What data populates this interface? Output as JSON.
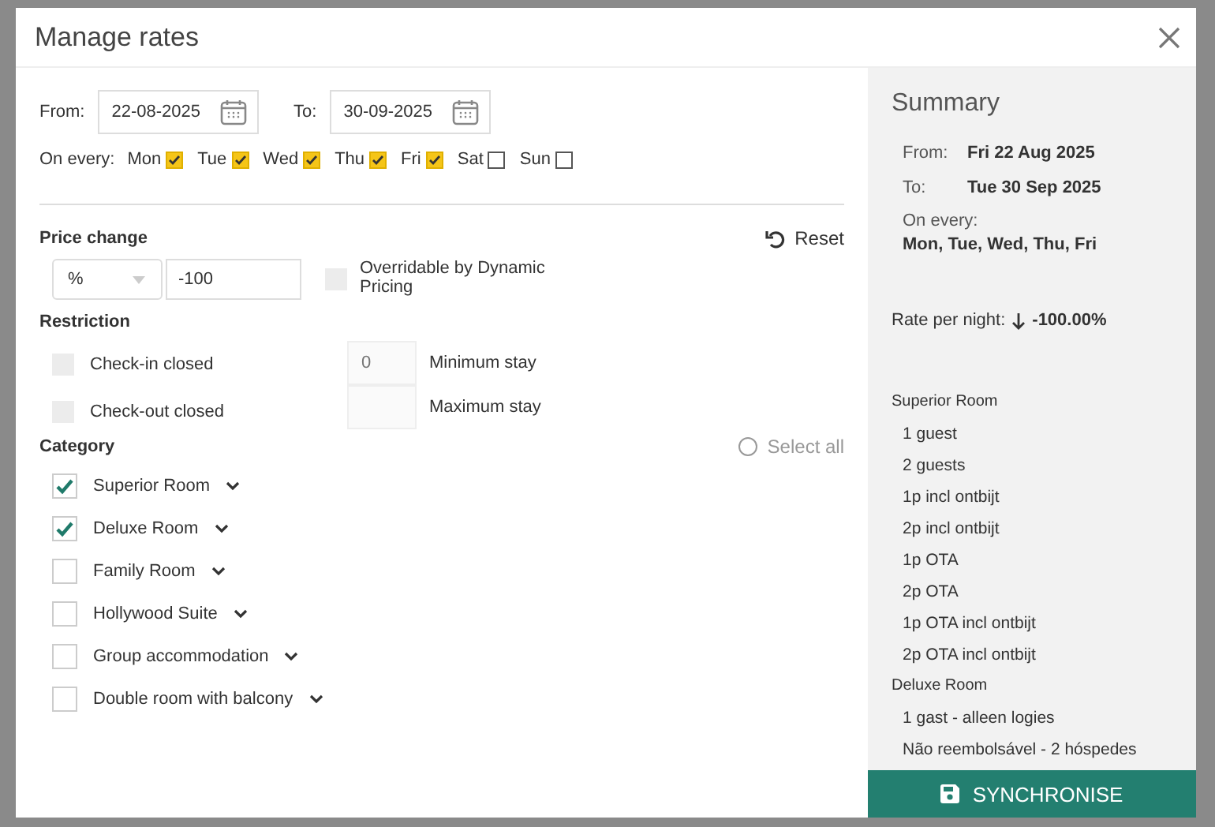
{
  "window": {
    "title": "Manage rates"
  },
  "dates": {
    "from": {
      "label": "From:",
      "value": "22-08-2025"
    },
    "to": {
      "label": "To:",
      "value": "30-09-2025"
    }
  },
  "weekdays": {
    "label": "On every:",
    "days": [
      {
        "label": "Mon",
        "checked": true
      },
      {
        "label": "Tue",
        "checked": true
      },
      {
        "label": "Wed",
        "checked": true
      },
      {
        "label": "Thu",
        "checked": true
      },
      {
        "label": "Fri",
        "checked": true
      },
      {
        "label": "Sat",
        "checked": false
      },
      {
        "label": "Sun",
        "checked": false
      }
    ]
  },
  "price_change": {
    "title": "Price change",
    "reset": "Reset",
    "unit": "%",
    "amount": "-100",
    "overridable": {
      "label": "Overridable by Dynamic Pricing",
      "checked": false
    }
  },
  "restriction": {
    "title": "Restriction",
    "checks": [
      {
        "label": "Check-in closed",
        "checked": false
      },
      {
        "label": "Check-out closed",
        "checked": false
      }
    ],
    "stays": [
      {
        "label": "Minimum stay",
        "placeholder": "0"
      },
      {
        "label": "Maximum stay"
      }
    ]
  },
  "category": {
    "title": "Category",
    "select_all": {
      "label": "Select all",
      "selected": false
    },
    "items": [
      {
        "label": "Superior Room",
        "checked": true
      },
      {
        "label": "Deluxe Room",
        "checked": true
      },
      {
        "label": "Family Room",
        "checked": false
      },
      {
        "label": "Hollywood Suite",
        "checked": false
      },
      {
        "label": "Group accommodation",
        "checked": false
      },
      {
        "label": "Double room with balcony",
        "checked": false
      }
    ]
  },
  "summary": {
    "title": "Summary",
    "from": {
      "label": "From:",
      "value": "Fri 22 Aug 2025"
    },
    "to": {
      "label": "To:",
      "value": "Tue 30 Sep 2025"
    },
    "on_every": {
      "label": "On every:",
      "value": "Mon, Tue, Wed, Thu, Fri"
    },
    "rate": {
      "label": "Rate per night:",
      "value": "-100.00%"
    },
    "groups": [
      {
        "name": "Superior Room",
        "items": [
          "1 guest",
          "2 guests",
          "1p incl ontbijt",
          "2p incl ontbijt",
          "1p OTA",
          "2p OTA",
          "1p OTA incl ontbijt",
          "2p OTA incl ontbijt"
        ]
      },
      {
        "name": "Deluxe Room",
        "items": [
          "1 gast - alleen logies",
          "Não reembolsável - 2 hóspedes"
        ]
      }
    ]
  },
  "synchronise": "SYNCHRONISE"
}
